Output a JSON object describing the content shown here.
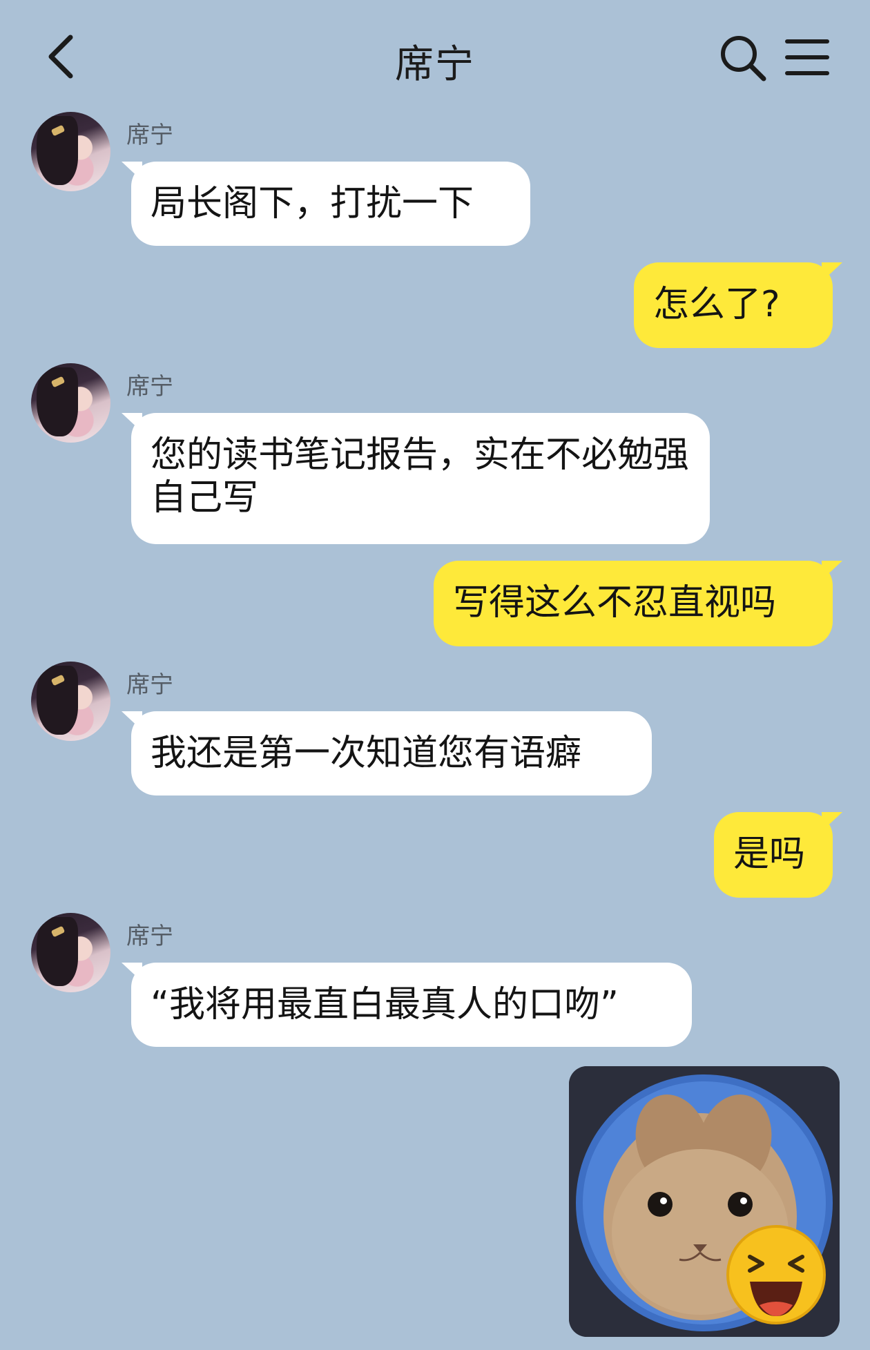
{
  "header": {
    "title": "席宁",
    "back_icon": "chevron-left-icon",
    "search_icon": "search-icon",
    "menu_icon": "menu-icon"
  },
  "messages": [
    {
      "direction": "incoming",
      "sender": "席宁",
      "text": "局长阁下，打扰一下"
    },
    {
      "direction": "outgoing",
      "text": "怎么了?"
    },
    {
      "direction": "incoming",
      "sender": "席宁",
      "text": "您的读书笔记报告，实在不必勉强自己写"
    },
    {
      "direction": "outgoing",
      "text": "写得这么不忍直视吗"
    },
    {
      "direction": "incoming",
      "sender": "席宁",
      "text": "我还是第一次知道您有语癖"
    },
    {
      "direction": "outgoing",
      "text": "是吗"
    },
    {
      "direction": "incoming",
      "sender": "席宁",
      "text": "“我将用最直白最真人的口吻”"
    },
    {
      "direction": "outgoing",
      "type": "sticker",
      "sticker": "cat-laughing-sticker"
    }
  ],
  "colors": {
    "background": "#abc1d6",
    "incoming_bubble": "#ffffff",
    "outgoing_bubble": "#fee93a"
  }
}
